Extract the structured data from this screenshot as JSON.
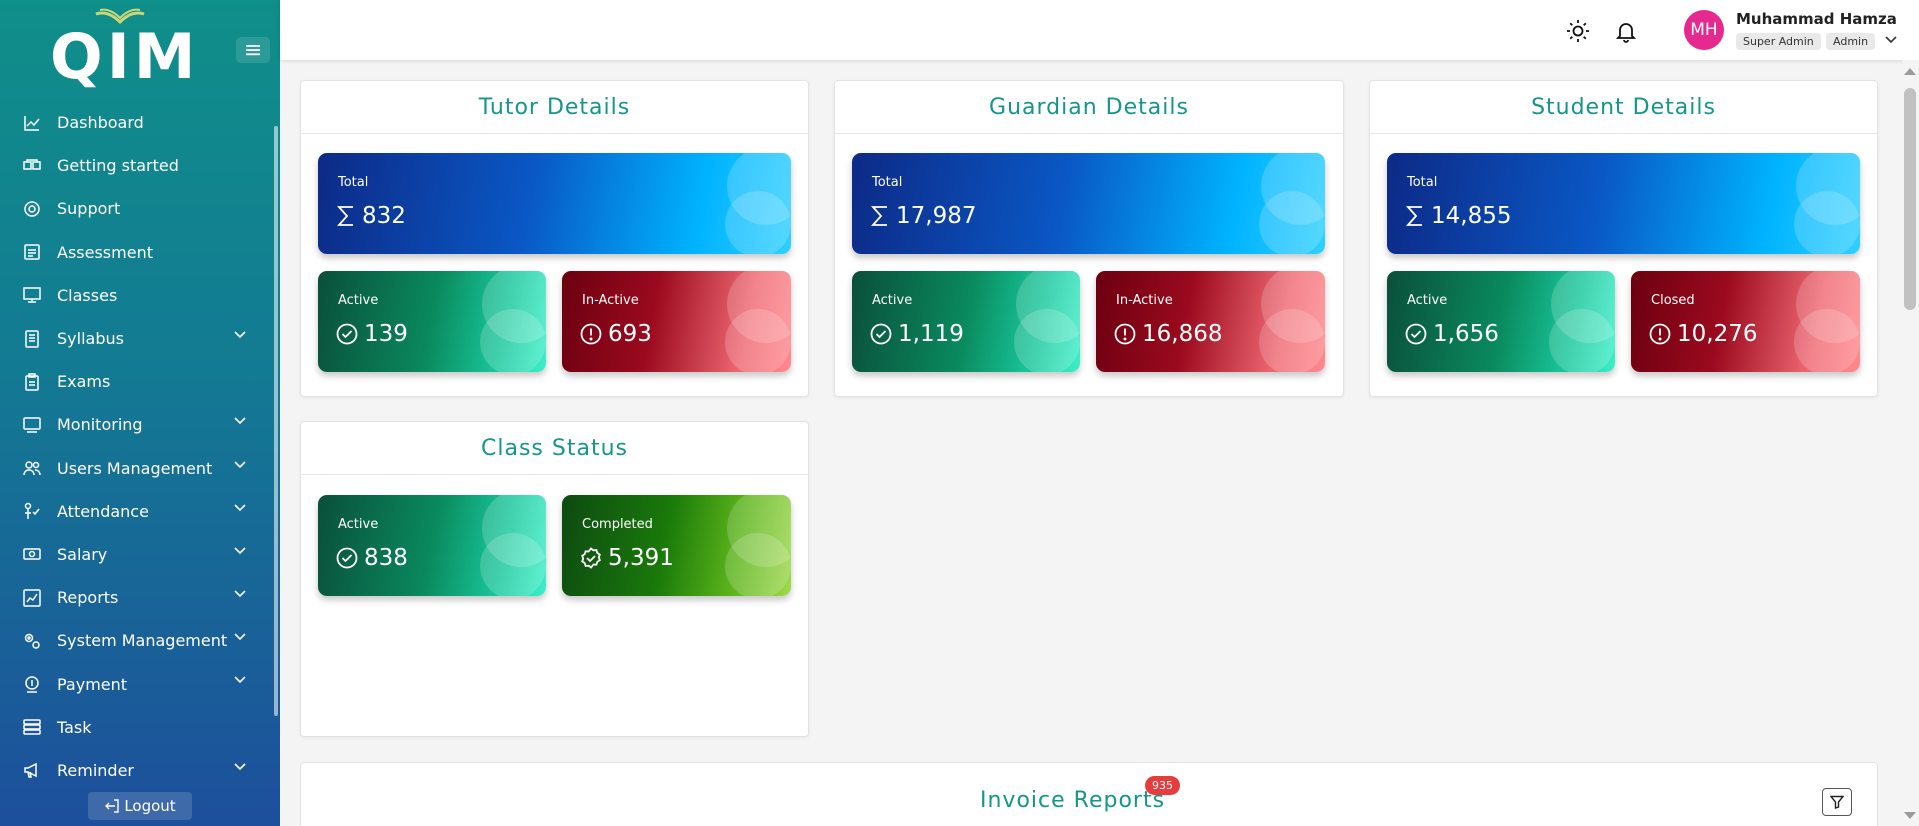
{
  "app": {
    "logo_text": "QIM"
  },
  "sidebar": {
    "items": [
      {
        "label": "Dashboard",
        "icon": "chart-line-icon",
        "has_submenu": false
      },
      {
        "label": "Getting started",
        "icon": "boxes-icon",
        "has_submenu": false
      },
      {
        "label": "Support",
        "icon": "support-icon",
        "has_submenu": false
      },
      {
        "label": "Assessment",
        "icon": "assessment-icon",
        "has_submenu": false
      },
      {
        "label": "Classes",
        "icon": "classes-icon",
        "has_submenu": false
      },
      {
        "label": "Syllabus",
        "icon": "syllabus-icon",
        "has_submenu": true
      },
      {
        "label": "Exams",
        "icon": "clipboard-icon",
        "has_submenu": false
      },
      {
        "label": "Monitoring",
        "icon": "monitor-icon",
        "has_submenu": true
      },
      {
        "label": "Users Management",
        "icon": "users-icon",
        "has_submenu": true
      },
      {
        "label": "Attendance",
        "icon": "attendance-icon",
        "has_submenu": true
      },
      {
        "label": "Salary",
        "icon": "money-icon",
        "has_submenu": true
      },
      {
        "label": "Reports",
        "icon": "reports-icon",
        "has_submenu": true
      },
      {
        "label": "System Management",
        "icon": "settings-icon",
        "has_submenu": true
      },
      {
        "label": "Payment",
        "icon": "payment-icon",
        "has_submenu": true
      },
      {
        "label": "Task",
        "icon": "task-icon",
        "has_submenu": false
      },
      {
        "label": "Reminder",
        "icon": "megaphone-icon",
        "has_submenu": true
      }
    ],
    "logout_label": "Logout"
  },
  "header": {
    "user": {
      "initials": "MH",
      "name": "Muhammad Hamza",
      "roles": [
        "Super Admin",
        "Admin"
      ]
    }
  },
  "panels": {
    "tutor": {
      "title": "Tutor Details",
      "total": {
        "label": "Total",
        "value": "832"
      },
      "active": {
        "label": "Active",
        "value": "139"
      },
      "inactive": {
        "label": "In-Active",
        "value": "693"
      }
    },
    "guardian": {
      "title": "Guardian Details",
      "total": {
        "label": "Total",
        "value": "17,987"
      },
      "active": {
        "label": "Active",
        "value": "1,119"
      },
      "inactive": {
        "label": "In-Active",
        "value": "16,868"
      }
    },
    "student": {
      "title": "Student Details",
      "total": {
        "label": "Total",
        "value": "14,855"
      },
      "active": {
        "label": "Active",
        "value": "1,656"
      },
      "inactive": {
        "label": "Closed",
        "value": "10,276"
      }
    },
    "class_status": {
      "title": "Class Status",
      "active": {
        "label": "Active",
        "value": "838"
      },
      "completed": {
        "label": "Completed",
        "value": "5,391"
      }
    },
    "invoice": {
      "title": "Invoice Reports",
      "badge": "935"
    }
  },
  "colors": {
    "accent": "#14968a",
    "avatar": "#e6298f",
    "badge": "#e53d3d"
  }
}
